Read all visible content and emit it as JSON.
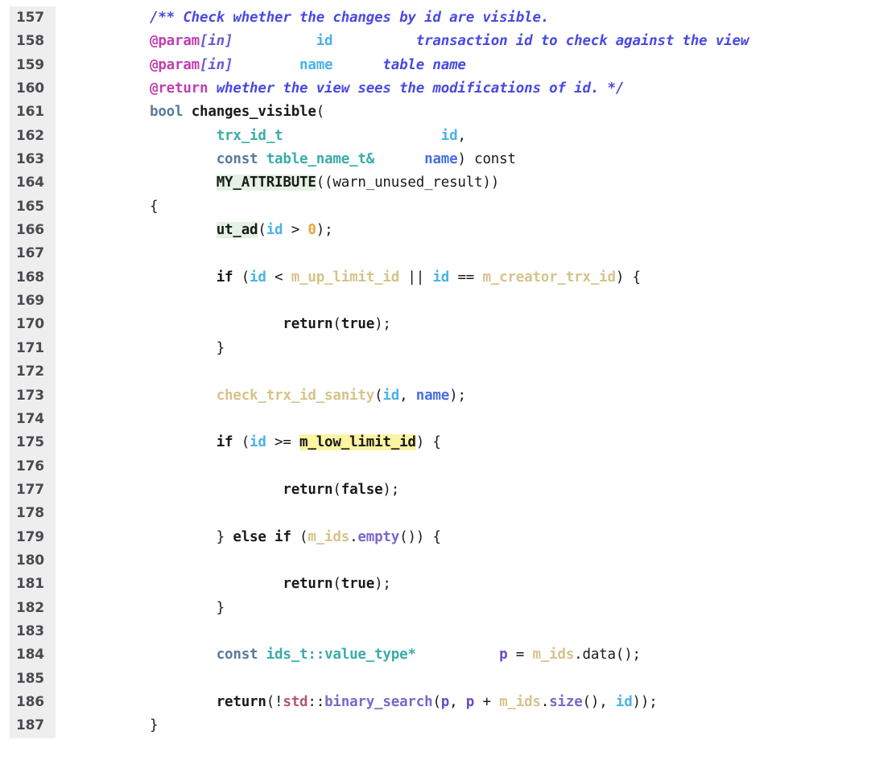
{
  "viewer": {
    "kind": "source-code-listing",
    "language": "C++",
    "first_line": 157,
    "last_line": 187,
    "gutter_bg": "#eeeeee",
    "page_bg": "#ffffff",
    "highlight_bg": "#fcf4a3",
    "highlight_term": "m_low_limit_id"
  },
  "lines": [
    {
      "number": "157",
      "tokens": [
        {
          "cls": "t-comment",
          "text": "/** Check whether the changes by id are visible."
        }
      ]
    },
    {
      "number": "158",
      "tokens": [
        {
          "cls": "t-doctag",
          "text": "@param"
        },
        {
          "cls": "t-docparam",
          "text": "[in]"
        },
        {
          "cls": "t-plain",
          "text": "          "
        },
        {
          "cls": "t-param",
          "text": "id"
        },
        {
          "cls": "t-plain",
          "text": "          "
        },
        {
          "cls": "t-comment",
          "text": "transaction id to check against the view"
        }
      ]
    },
    {
      "number": "159",
      "tokens": [
        {
          "cls": "t-doctag",
          "text": "@param"
        },
        {
          "cls": "t-docparam",
          "text": "[in]"
        },
        {
          "cls": "t-plain",
          "text": "        "
        },
        {
          "cls": "t-param",
          "text": "name"
        },
        {
          "cls": "t-plain",
          "text": "      "
        },
        {
          "cls": "t-comment",
          "text": "table name"
        }
      ]
    },
    {
      "number": "160",
      "tokens": [
        {
          "cls": "t-doctag",
          "text": "@return"
        },
        {
          "cls": "t-comment",
          "text": " whether the view sees the modifications of id. */"
        }
      ]
    },
    {
      "number": "161",
      "tokens": [
        {
          "cls": "t-keyword",
          "text": "bool"
        },
        {
          "cls": "t-plain",
          "text": " "
        },
        {
          "cls": "t-fname",
          "text": "changes_visible"
        },
        {
          "cls": "t-plain",
          "text": "("
        }
      ]
    },
    {
      "number": "162",
      "tokens": [
        {
          "cls": "t-plain",
          "text": "        "
        },
        {
          "cls": "t-type",
          "text": "trx_id_t"
        },
        {
          "cls": "t-plain",
          "text": "                   "
        },
        {
          "cls": "t-param",
          "text": "id"
        },
        {
          "cls": "t-plain",
          "text": ","
        }
      ]
    },
    {
      "number": "163",
      "tokens": [
        {
          "cls": "t-plain",
          "text": "        "
        },
        {
          "cls": "t-keyword",
          "text": "const"
        },
        {
          "cls": "t-plain",
          "text": " "
        },
        {
          "cls": "t-type",
          "text": "table_name_t&"
        },
        {
          "cls": "t-plain",
          "text": "      "
        },
        {
          "cls": "t-paramblue",
          "text": "name"
        },
        {
          "cls": "t-plain",
          "text": ") "
        },
        {
          "cls": "t-plain",
          "text": "const"
        }
      ]
    },
    {
      "number": "164",
      "tokens": [
        {
          "cls": "t-plain",
          "text": "        "
        },
        {
          "cls": "t-macro",
          "text": "MY_ATTRIBUTE"
        },
        {
          "cls": "t-plain",
          "text": "((warn_unused_result))"
        }
      ]
    },
    {
      "number": "165",
      "tokens": [
        {
          "cls": "t-plain",
          "text": "{"
        }
      ]
    },
    {
      "number": "166",
      "tokens": [
        {
          "cls": "t-plain",
          "text": "        "
        },
        {
          "cls": "t-macro",
          "text": "ut_ad"
        },
        {
          "cls": "t-plain",
          "text": "("
        },
        {
          "cls": "t-param",
          "text": "id"
        },
        {
          "cls": "t-plain",
          "text": " > "
        },
        {
          "cls": "t-number",
          "text": "0"
        },
        {
          "cls": "t-plain",
          "text": ");"
        }
      ]
    },
    {
      "number": "167",
      "tokens": []
    },
    {
      "number": "168",
      "tokens": [
        {
          "cls": "t-plain",
          "text": "        "
        },
        {
          "cls": "t-kw-dark",
          "text": "if"
        },
        {
          "cls": "t-plain",
          "text": " ("
        },
        {
          "cls": "t-param",
          "text": "id"
        },
        {
          "cls": "t-plain",
          "text": " < "
        },
        {
          "cls": "t-ident",
          "text": "m_up_limit_id"
        },
        {
          "cls": "t-plain",
          "text": " || "
        },
        {
          "cls": "t-param",
          "text": "id"
        },
        {
          "cls": "t-plain",
          "text": " == "
        },
        {
          "cls": "t-ident",
          "text": "m_creator_trx_id"
        },
        {
          "cls": "t-plain",
          "text": ") {"
        }
      ]
    },
    {
      "number": "169",
      "tokens": []
    },
    {
      "number": "170",
      "tokens": [
        {
          "cls": "t-plain",
          "text": "                "
        },
        {
          "cls": "t-kw-dark",
          "text": "return"
        },
        {
          "cls": "t-plain",
          "text": "("
        },
        {
          "cls": "t-kw-dark",
          "text": "true"
        },
        {
          "cls": "t-plain",
          "text": ");"
        }
      ]
    },
    {
      "number": "171",
      "tokens": [
        {
          "cls": "t-plain",
          "text": "        }"
        }
      ]
    },
    {
      "number": "172",
      "tokens": []
    },
    {
      "number": "173",
      "tokens": [
        {
          "cls": "t-plain",
          "text": "        "
        },
        {
          "cls": "t-ident",
          "text": "check_trx_id_sanity"
        },
        {
          "cls": "t-plain",
          "text": "("
        },
        {
          "cls": "t-param",
          "text": "id"
        },
        {
          "cls": "t-plain",
          "text": ", "
        },
        {
          "cls": "t-paramblue",
          "text": "name"
        },
        {
          "cls": "t-plain",
          "text": ");"
        }
      ]
    },
    {
      "number": "174",
      "tokens": []
    },
    {
      "number": "175",
      "tokens": [
        {
          "cls": "t-plain",
          "text": "        "
        },
        {
          "cls": "t-kw-dark",
          "text": "if"
        },
        {
          "cls": "t-plain",
          "text": " ("
        },
        {
          "cls": "t-param",
          "text": "id"
        },
        {
          "cls": "t-plain",
          "text": " >= "
        },
        {
          "cls": "t-highlight",
          "text": "m_low_limit_id"
        },
        {
          "cls": "t-plain",
          "text": ") {"
        }
      ]
    },
    {
      "number": "176",
      "tokens": []
    },
    {
      "number": "177",
      "tokens": [
        {
          "cls": "t-plain",
          "text": "                "
        },
        {
          "cls": "t-kw-dark",
          "text": "return"
        },
        {
          "cls": "t-plain",
          "text": "("
        },
        {
          "cls": "t-kw-dark",
          "text": "false"
        },
        {
          "cls": "t-plain",
          "text": ");"
        }
      ]
    },
    {
      "number": "178",
      "tokens": []
    },
    {
      "number": "179",
      "tokens": [
        {
          "cls": "t-plain",
          "text": "        } "
        },
        {
          "cls": "t-kw-dark",
          "text": "else if"
        },
        {
          "cls": "t-plain",
          "text": " ("
        },
        {
          "cls": "t-ident",
          "text": "m_ids"
        },
        {
          "cls": "t-plain",
          "text": "."
        },
        {
          "cls": "t-member",
          "text": "empty"
        },
        {
          "cls": "t-plain",
          "text": "()) {"
        }
      ]
    },
    {
      "number": "180",
      "tokens": []
    },
    {
      "number": "181",
      "tokens": [
        {
          "cls": "t-plain",
          "text": "                "
        },
        {
          "cls": "t-kw-dark",
          "text": "return"
        },
        {
          "cls": "t-plain",
          "text": "("
        },
        {
          "cls": "t-kw-dark",
          "text": "true"
        },
        {
          "cls": "t-plain",
          "text": ");"
        }
      ]
    },
    {
      "number": "182",
      "tokens": [
        {
          "cls": "t-plain",
          "text": "        }"
        }
      ]
    },
    {
      "number": "183",
      "tokens": []
    },
    {
      "number": "184",
      "tokens": [
        {
          "cls": "t-plain",
          "text": "        "
        },
        {
          "cls": "t-keyword",
          "text": "const"
        },
        {
          "cls": "t-plain",
          "text": " "
        },
        {
          "cls": "t-type",
          "text": "ids_t::value_type*"
        },
        {
          "cls": "t-plain",
          "text": "          "
        },
        {
          "cls": "t-var",
          "text": "p"
        },
        {
          "cls": "t-plain",
          "text": " = "
        },
        {
          "cls": "t-ident",
          "text": "m_ids"
        },
        {
          "cls": "t-plain",
          "text": "."
        },
        {
          "cls": "t-plain",
          "text": "data"
        },
        {
          "cls": "t-plain",
          "text": "();"
        }
      ]
    },
    {
      "number": "185",
      "tokens": []
    },
    {
      "number": "186",
      "tokens": [
        {
          "cls": "t-plain",
          "text": "        "
        },
        {
          "cls": "t-kw-dark",
          "text": "return"
        },
        {
          "cls": "t-plain",
          "text": "(!"
        },
        {
          "cls": "t-std",
          "text": "std"
        },
        {
          "cls": "t-plain",
          "text": "::"
        },
        {
          "cls": "t-member",
          "text": "binary_search"
        },
        {
          "cls": "t-plain",
          "text": "("
        },
        {
          "cls": "t-var",
          "text": "p"
        },
        {
          "cls": "t-plain",
          "text": ", "
        },
        {
          "cls": "t-var",
          "text": "p"
        },
        {
          "cls": "t-plain",
          "text": " + "
        },
        {
          "cls": "t-ident",
          "text": "m_ids"
        },
        {
          "cls": "t-plain",
          "text": "."
        },
        {
          "cls": "t-member",
          "text": "size"
        },
        {
          "cls": "t-plain",
          "text": "(), "
        },
        {
          "cls": "t-param",
          "text": "id"
        },
        {
          "cls": "t-plain",
          "text": "));"
        }
      ]
    },
    {
      "number": "187",
      "tokens": [
        {
          "cls": "t-plain",
          "text": "}"
        }
      ]
    }
  ]
}
